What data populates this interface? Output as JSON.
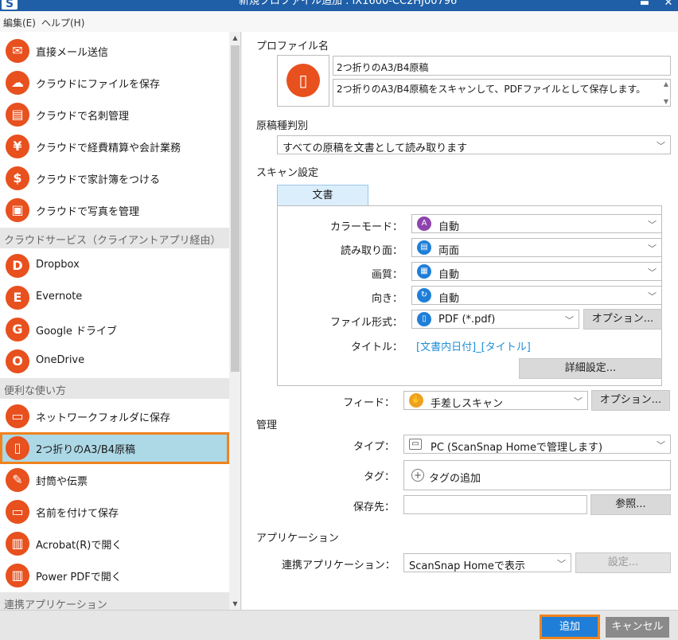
{
  "window": {
    "title": "新規プロファイル追加 : iX1600-CC2HJ00796",
    "minimize": "▬",
    "close": "✕"
  },
  "menu": {
    "edit": "編集(E)",
    "help": "ヘルプ(H)"
  },
  "left": {
    "items_top": [
      {
        "label": "直接メール送信",
        "icon": "mail-icon",
        "glyph": "✉"
      },
      {
        "label": "クラウドにファイルを保存",
        "icon": "cloud-upload-icon",
        "glyph": "☁"
      },
      {
        "label": "クラウドで名刺管理",
        "icon": "business-card-icon",
        "glyph": "▤"
      },
      {
        "label": "クラウドで経費精算や会計業務",
        "icon": "coins-icon",
        "glyph": "¥"
      },
      {
        "label": "クラウドで家計簿をつける",
        "icon": "receipt-icon",
        "glyph": "$"
      },
      {
        "label": "クラウドで写真を管理",
        "icon": "photo-icon",
        "glyph": "▣"
      }
    ],
    "header_cloud": "クラウドサービス（クライアントアプリ経由）",
    "items_cloud": [
      {
        "label": "Dropbox",
        "icon": "dropbox-icon",
        "glyph": "D"
      },
      {
        "label": "Evernote",
        "icon": "evernote-icon",
        "glyph": "E"
      },
      {
        "label": "Google ドライブ",
        "icon": "google-drive-icon",
        "glyph": "G"
      },
      {
        "label": "OneDrive",
        "icon": "onedrive-icon",
        "glyph": "O"
      }
    ],
    "header_useful": "便利な使い方",
    "items_useful": [
      {
        "label": "ネットワークフォルダに保存",
        "icon": "network-folder-icon",
        "glyph": "▭"
      },
      {
        "label": "2つ折りのA3/B4原稿",
        "icon": "folded-document-icon",
        "glyph": "▯"
      },
      {
        "label": "封筒や伝票",
        "icon": "envelope-icon",
        "glyph": "✎"
      },
      {
        "label": "名前を付けて保存",
        "icon": "folder-icon",
        "glyph": "▭"
      },
      {
        "label": "Acrobat(R)で開く",
        "icon": "book-icon",
        "glyph": "▥"
      },
      {
        "label": "Power PDFで開く",
        "icon": "book-icon",
        "glyph": "▥"
      }
    ],
    "header_apps": "連携アプリケーション"
  },
  "right": {
    "profile_name_label": "プロファイル名",
    "profile_name": "2つ折りのA3/B4原稿",
    "profile_desc": "2つ折りのA3/B4原稿をスキャンして、PDFファイルとして保存します。",
    "doc_type_label": "原稿種判別",
    "doc_type": "すべての原稿を文書として読み取ります",
    "scan_settings_label": "スキャン設定",
    "tab_document": "文書",
    "color_mode_label": "カラーモード：",
    "color_mode": "自動",
    "scan_side_label": "読み取り面：",
    "scan_side": "両面",
    "quality_label": "画質：",
    "quality": "自動",
    "orientation_label": "向き：",
    "orientation": "自動",
    "file_format_label": "ファイル形式：",
    "file_format": "PDF (*.pdf)",
    "options_label": "オプション...",
    "title_label": "タイトル：",
    "title_value": "[文書内日付]_[タイトル]",
    "detail_settings": "詳細設定...",
    "feed_label": "フィード：",
    "feed": "手差しスキャン",
    "feed_options": "オプション...",
    "manage_label": "管理",
    "type_label": "タイプ：",
    "type_value": "PC (ScanSnap Homeで管理します)",
    "tag_label": "タグ：",
    "tag_add": "タグの追加",
    "save_to_label": "保存先：",
    "save_to_value": "",
    "browse": "参照...",
    "app_section_label": "アプリケーション",
    "app_label": "連携アプリケーション：",
    "app_value": "ScanSnap Homeで表示",
    "app_settings": "設定..."
  },
  "buttons": {
    "add": "追加",
    "cancel": "キャンセル"
  },
  "colors": {
    "accent": "#e8501e",
    "selection": "#add8e6",
    "highlight": "#f0831d",
    "primary": "#1f7fd8"
  }
}
